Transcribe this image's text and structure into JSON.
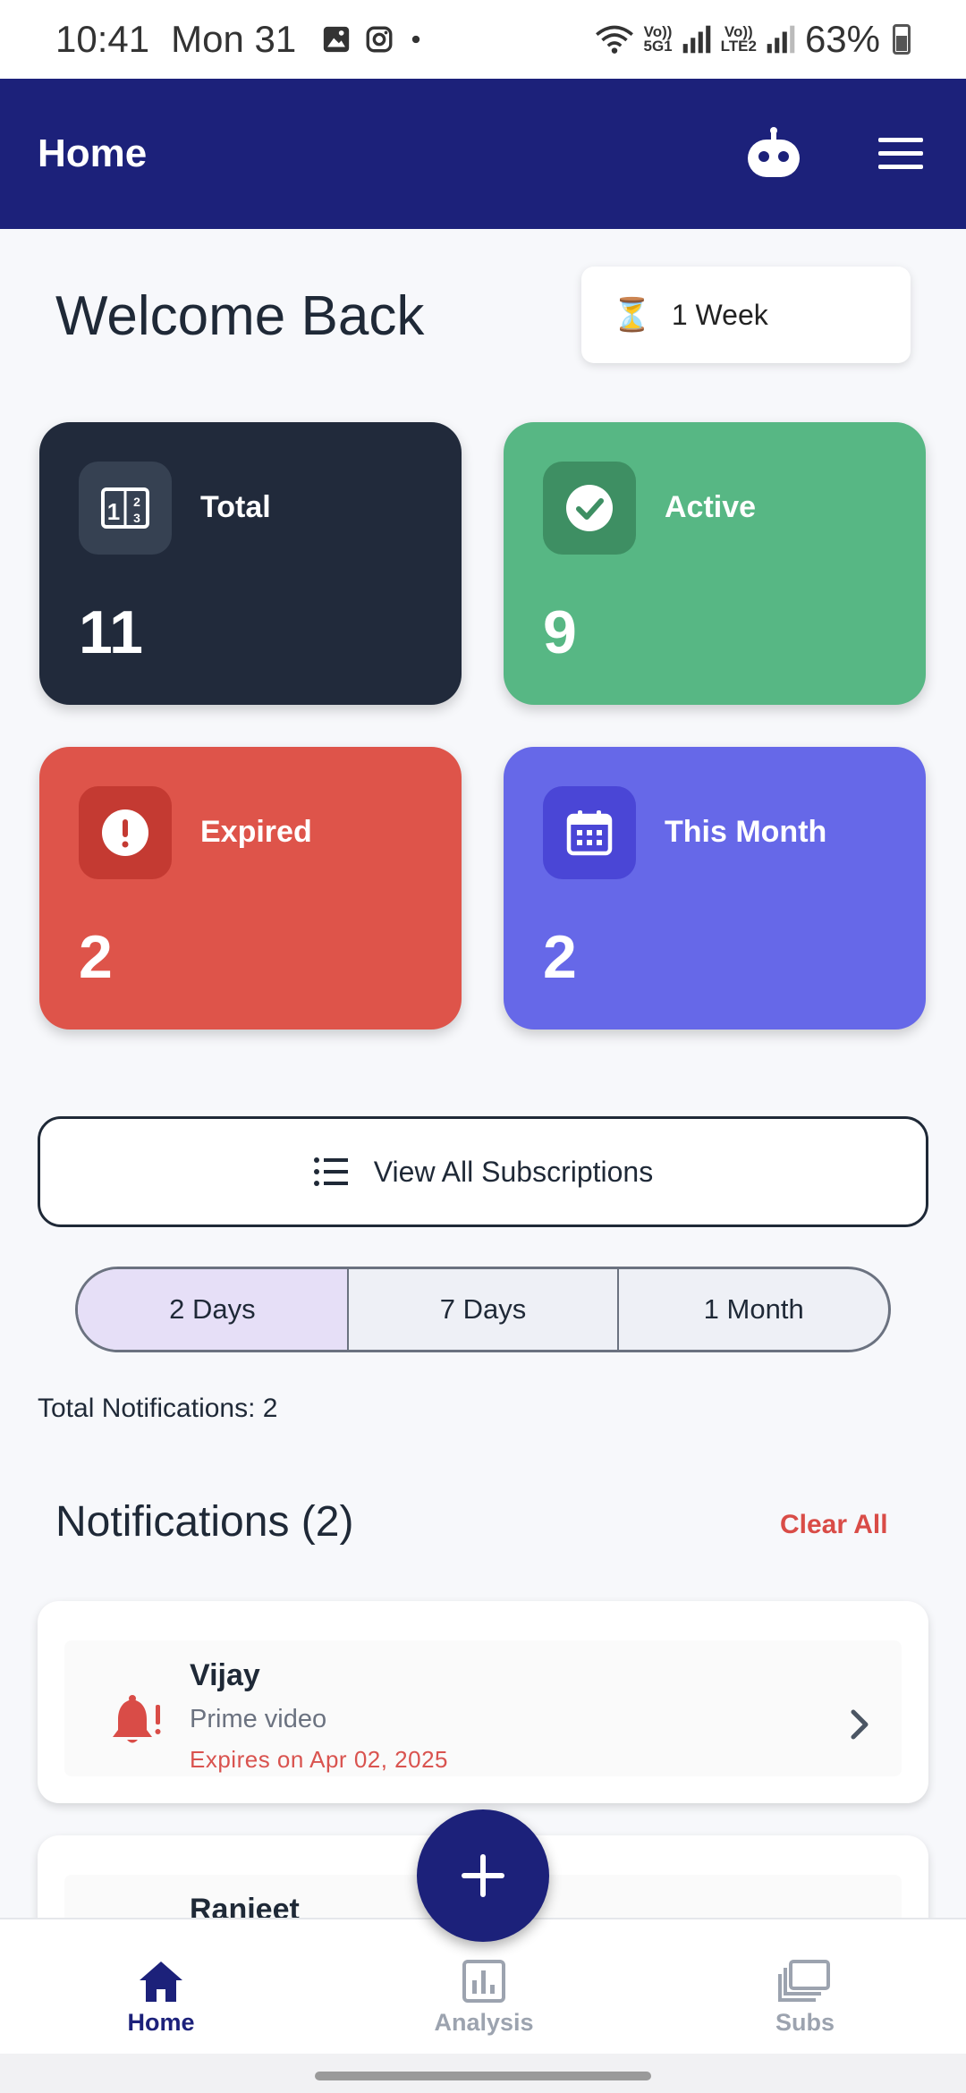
{
  "status_bar": {
    "time": "10:41",
    "date": "Mon 31",
    "net1_top": "Vo))",
    "net1_bottom": "5G1",
    "net2_top": "Vo))",
    "net2_bottom": "LTE2",
    "battery": "63%"
  },
  "app_bar": {
    "title": "Home",
    "bot_icon": "robot-icon",
    "menu_icon": "hamburger-menu-icon",
    "color": "#1c217a"
  },
  "welcome": {
    "title": "Welcome Back",
    "period_label": "1 Week",
    "period_icon": "hourglass-icon"
  },
  "stats": [
    {
      "label": "Total",
      "value": "11",
      "icon": "counter-icon",
      "color": "#212a3b"
    },
    {
      "label": "Active",
      "value": "9",
      "icon": "check-circle-icon",
      "color": "#57b784"
    },
    {
      "label": "Expired",
      "value": "2",
      "icon": "alert-circle-icon",
      "color": "#de544a"
    },
    {
      "label": "This Month",
      "value": "2",
      "icon": "calendar-icon",
      "color": "#6668e8"
    }
  ],
  "view_all": {
    "label": "View All Subscriptions",
    "icon": "list-icon"
  },
  "filter": {
    "options": [
      "2 Days",
      "7 Days",
      "1 Month"
    ],
    "selected": "2 Days"
  },
  "total_notifications": "Total Notifications: 2",
  "notifications": {
    "title": "Notifications (2)",
    "clear_label": "Clear All",
    "items": [
      {
        "name": "Vijay",
        "service": "Prime video",
        "expiry": "Expires on Apr 02, 2025"
      },
      {
        "name": "Ranjeet",
        "service": "",
        "expiry": ""
      }
    ]
  },
  "fab": {
    "icon": "plus-icon"
  },
  "bottom_nav": {
    "items": [
      {
        "label": "Home",
        "icon": "home-icon",
        "active": true
      },
      {
        "label": "Analysis",
        "icon": "bar-chart-icon",
        "active": false
      },
      {
        "label": "Subs",
        "icon": "stacked-cards-icon",
        "active": false
      }
    ]
  }
}
